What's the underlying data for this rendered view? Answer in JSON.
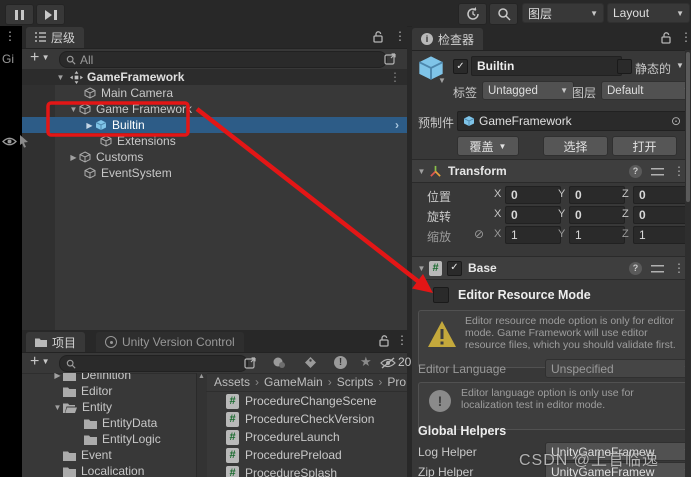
{
  "toolbar": {
    "layers_label": "图层",
    "layout_label": "Layout"
  },
  "strip": {
    "label": "Gi"
  },
  "hierarchy": {
    "tab_label": "层级",
    "add_label": "+",
    "search_text": "All",
    "scene_label": "GameFramework",
    "items": [
      {
        "label": "Main Camera"
      },
      {
        "label": "Game Framework"
      },
      {
        "label": "Builtin"
      },
      {
        "label": "Extensions"
      },
      {
        "label": "Customs"
      },
      {
        "label": "EventSystem"
      }
    ]
  },
  "project": {
    "tab_label": "项目",
    "vcs_tab_label": "Unity Version Control",
    "add_label": "+",
    "hidden_count": "20",
    "folders": [
      {
        "label": "Definition"
      },
      {
        "label": "Editor"
      },
      {
        "label": "Entity"
      },
      {
        "label": "EntityData"
      },
      {
        "label": "EntityLogic"
      },
      {
        "label": "Event"
      },
      {
        "label": "Localication"
      }
    ],
    "breadcrumb": [
      "Assets",
      "GameMain",
      "Scripts",
      "Pro"
    ],
    "files": [
      {
        "label": "ProcedureChangeScene"
      },
      {
        "label": "ProcedureCheckVersion"
      },
      {
        "label": "ProcedureLaunch"
      },
      {
        "label": "ProcedurePreload"
      },
      {
        "label": "ProcedureSplash"
      }
    ]
  },
  "inspector": {
    "tab_label": "检查器",
    "name_value": "Builtin",
    "static_label": "静态的",
    "tag_label": "标签",
    "tag_value": "Untagged",
    "layer_label": "图层",
    "layer_value": "Default",
    "prefab_label": "预制件",
    "prefab_value": "GameFramework",
    "overrides_label": "覆盖",
    "select_label": "选择",
    "open_label": "打开",
    "transform": {
      "title": "Transform",
      "axis_x": "X",
      "axis_y": "Y",
      "axis_z": "Z",
      "rows": [
        {
          "label": "位置",
          "x": "0",
          "y": "0",
          "z": "0"
        },
        {
          "label": "旋转",
          "x": "0",
          "y": "0",
          "z": "0"
        },
        {
          "label": "缩放",
          "x": "1",
          "y": "1",
          "z": "1"
        }
      ]
    },
    "base": {
      "title": "Base",
      "erm_label": "Editor Resource Mode",
      "warning_text": "Editor resource mode option is only for editor mode. Game Framework will use editor resource files, which you should validate first.",
      "language_label": "Editor Language",
      "language_value": "Unspecified",
      "info_text": "Editor language option is only use for localization test in editor mode.",
      "global_helpers_label": "Global Helpers",
      "log_helper_label": "Log Helper",
      "zip_helper_label": "Zip Helper",
      "helper_value": "UnityGameFramew"
    }
  },
  "watermark": "CSDN @上官临逸",
  "colors": {
    "selection": "#2D5C87",
    "annotation": "#E31616",
    "warning": "#C4A93C",
    "prefab_blue": "#7FC4E8",
    "script_green": "#17692C"
  }
}
